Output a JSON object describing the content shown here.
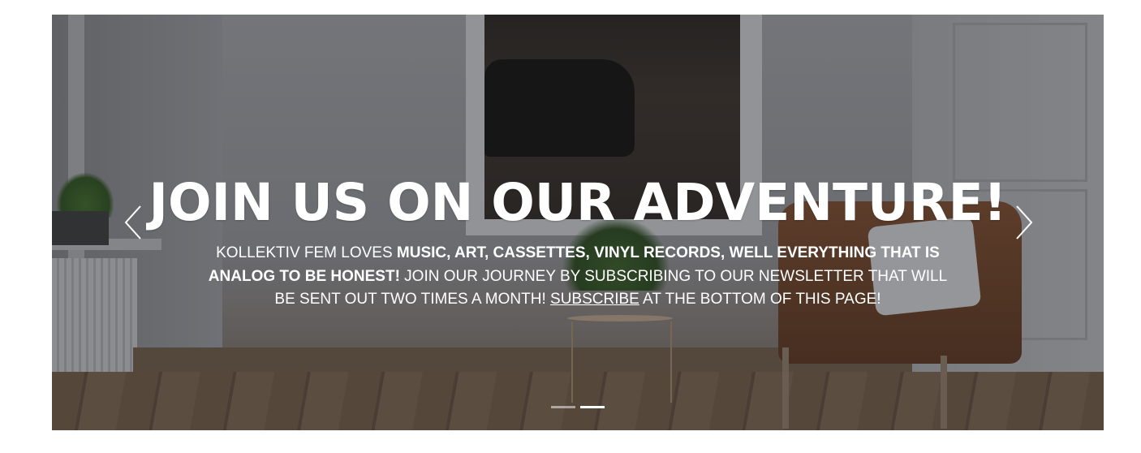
{
  "hero": {
    "title": "JOIN US ON OUR ADVENTURE!",
    "text_parts": {
      "p1": "KOLLEKTIV FEM LOVES ",
      "p2_bold": "MUSIC, ART, CASSETTES, VINYL RECORDS, WELL EVERYTHING THAT IS ANALOG TO BE HONEST!",
      "p3": " JOIN OUR JOURNEY BY SUBSCRIBING TO OUR NEWSLETTER THAT WILL BE SENT OUT TWO TIMES A MONTH! ",
      "p4_link": "SUBSCRIBE",
      "p5": " AT THE BOTTOM OF THIS PAGE!"
    }
  },
  "slider": {
    "prev_icon": "chevron-left-icon",
    "next_icon": "chevron-right-icon",
    "total_slides": 2,
    "active_slide": 2
  },
  "colors": {
    "text": "#ffffff",
    "overlay": "rgba(30,30,35,0.32)"
  }
}
